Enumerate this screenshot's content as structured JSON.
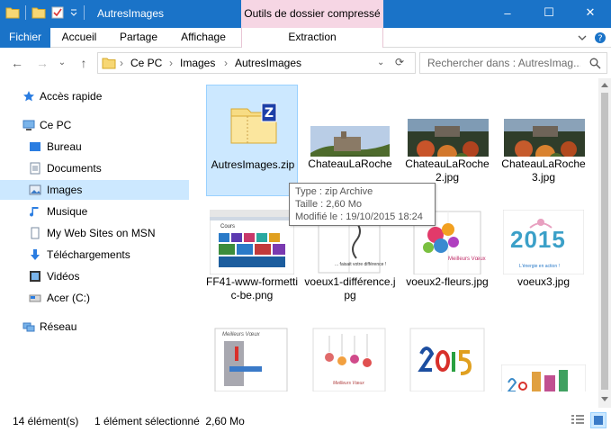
{
  "window": {
    "title": "AutresImages",
    "minimize": "–",
    "maximize": "☐",
    "close": "✕"
  },
  "ribbon": {
    "context_group": "Outils de dossier compressé",
    "tabs": [
      "Fichier",
      "Accueil",
      "Partage",
      "Affichage"
    ],
    "context_tab": "Extraction"
  },
  "address": {
    "crumbs": [
      "Ce PC",
      "Images",
      "AutresImages"
    ],
    "search_placeholder": "Rechercher dans : AutresImag..."
  },
  "nav": {
    "items": [
      {
        "label": "Accès rapide",
        "icon": "star-icon"
      },
      {
        "label": "Ce PC",
        "icon": "computer-icon"
      },
      {
        "label": "Bureau",
        "icon": "desktop-icon"
      },
      {
        "label": "Documents",
        "icon": "documents-icon"
      },
      {
        "label": "Images",
        "icon": "pictures-icon"
      },
      {
        "label": "Musique",
        "icon": "music-icon"
      },
      {
        "label": "My Web Sites on MSN",
        "icon": "web-sites-icon"
      },
      {
        "label": "Téléchargements",
        "icon": "download-icon"
      },
      {
        "label": "Vidéos",
        "icon": "video-icon"
      },
      {
        "label": "Acer (C:)",
        "icon": "drive-icon"
      },
      {
        "label": "Réseau",
        "icon": "network-icon"
      }
    ]
  },
  "files": [
    {
      "name": "AutresImages.zip"
    },
    {
      "name": "ChateauLaRoche"
    },
    {
      "name": "ChateauLaRoche2.jpg"
    },
    {
      "name": "ChateauLaRoche3.jpg"
    },
    {
      "name": "FF41-www-formettic-be.png"
    },
    {
      "name": "voeux1-différence.jpg"
    },
    {
      "name": "voeux2-fleurs.jpg"
    },
    {
      "name": "voeux3.jpg"
    },
    {
      "name": ""
    },
    {
      "name": ""
    },
    {
      "name": ""
    },
    {
      "name": ""
    }
  ],
  "thumb_text": {
    "ff41_title": "Cours",
    "voeux1_text": "... faisait votre différence !",
    "voeux2_text": "Meilleurs Vœux",
    "voeux3_year": "2015",
    "voeux3_sub": "L'énergie en action !",
    "row3a_text": "Meilleurs Vœux",
    "row3b_text": "Meilleurs Vœux"
  },
  "tooltip": {
    "type": "Type : zip Archive",
    "size": "Taille : 2,60 Mo",
    "modified": "Modifié le : 19/10/2015 18:24"
  },
  "status": {
    "count": "14 élément(s)",
    "selection": "1 élément sélectionné  2,60 Mo"
  },
  "colors": {
    "accent": "#1a73c8",
    "selection": "#cce8ff",
    "context_tab": "#f6d6e4"
  }
}
